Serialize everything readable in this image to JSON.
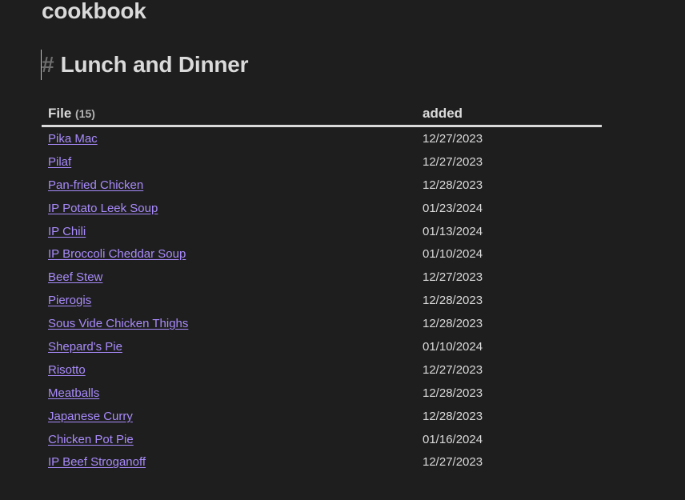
{
  "note": {
    "title": "cookbook",
    "heading_marker": "#",
    "heading": "Lunch and Dinner"
  },
  "table": {
    "columns": {
      "file_label": "File",
      "file_count": "(15)",
      "added_label": "added"
    },
    "rows": [
      {
        "file": "Pika Mac",
        "added": "12/27/2023"
      },
      {
        "file": "Pilaf",
        "added": "12/27/2023"
      },
      {
        "file": "Pan-fried Chicken",
        "added": "12/28/2023"
      },
      {
        "file": "IP Potato Leek Soup",
        "added": "01/23/2024"
      },
      {
        "file": "IP Chili",
        "added": "01/13/2024"
      },
      {
        "file": "IP Broccoli Cheddar Soup",
        "added": "01/10/2024"
      },
      {
        "file": "Beef Stew",
        "added": "12/27/2023"
      },
      {
        "file": "Pierogis",
        "added": "12/28/2023"
      },
      {
        "file": "Sous Vide Chicken Thighs",
        "added": "12/28/2023"
      },
      {
        "file": "Shepard's Pie",
        "added": "01/10/2024"
      },
      {
        "file": "Risotto",
        "added": "12/27/2023"
      },
      {
        "file": "Meatballs",
        "added": "12/28/2023"
      },
      {
        "file": "Japanese Curry",
        "added": "12/28/2023"
      },
      {
        "file": "Chicken Pot Pie",
        "added": "01/16/2024"
      },
      {
        "file": "IP Beef Stroganoff",
        "added": "12/27/2023"
      }
    ]
  },
  "colors": {
    "background": "#1e1e1e",
    "text": "#dadada",
    "link": "#a88bfa",
    "heading_marker": "#6e6e6e"
  }
}
